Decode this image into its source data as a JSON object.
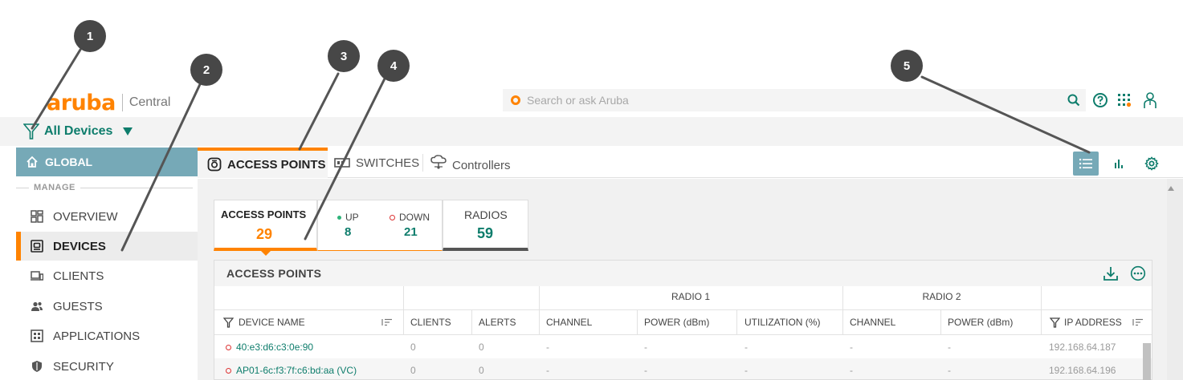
{
  "header": {
    "logo": "aruba",
    "product": "Central",
    "search_placeholder": "Search or ask Aruba"
  },
  "filter": {
    "label": "All Devices"
  },
  "sidebar": {
    "global": "GLOBAL",
    "section": "MANAGE",
    "items": [
      {
        "label": "OVERVIEW"
      },
      {
        "label": "DEVICES"
      },
      {
        "label": "CLIENTS"
      },
      {
        "label": "GUESTS"
      },
      {
        "label": "APPLICATIONS"
      },
      {
        "label": "SECURITY"
      }
    ]
  },
  "tabs": [
    {
      "label": "ACCESS POINTS"
    },
    {
      "label": "SWITCHES"
    },
    {
      "label": "Controllers"
    }
  ],
  "summary": {
    "access_points": {
      "title": "ACCESS POINTS",
      "value": "29"
    },
    "up": {
      "label": "UP",
      "value": "8"
    },
    "down": {
      "label": "DOWN",
      "value": "21"
    },
    "radios": {
      "title": "RADIOS",
      "value": "59"
    }
  },
  "table": {
    "title": "ACCESS POINTS",
    "groups": {
      "radio1": "RADIO 1",
      "radio2": "RADIO 2"
    },
    "columns": [
      "DEVICE NAME",
      "CLIENTS",
      "ALERTS",
      "CHANNEL",
      "POWER (dBm)",
      "UTILIZATION (%)",
      "CHANNEL",
      "POWER (dBm)",
      "IP ADDRESS"
    ],
    "rows": [
      {
        "name": "40:e3:d6:c3:0e:90",
        "clients": "0",
        "alerts": "0",
        "r1_channel": "-",
        "r1_power": "-",
        "r1_util": "-",
        "r2_channel": "-",
        "r2_power": "-",
        "ip": "192.168.64.187"
      },
      {
        "name": "AP01-6c:f3:7f:c6:bd:aa (VC)",
        "clients": "0",
        "alerts": "0",
        "r1_channel": "-",
        "r1_power": "-",
        "r1_util": "-",
        "r2_channel": "-",
        "r2_power": "-",
        "ip": "192.168.64.196"
      }
    ]
  },
  "callouts": [
    "1",
    "2",
    "3",
    "4",
    "5"
  ],
  "colors": {
    "accent": "#ff8300",
    "teal": "#0e7d6c",
    "global_bg": "#76a9b7",
    "down": "#dd3333"
  }
}
